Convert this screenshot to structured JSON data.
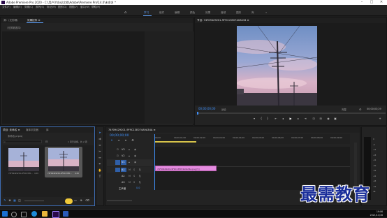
{
  "app": {
    "title": "Adobe Premiere Pro 2020 - C:\\用户\\Ysbsj\\文档\\Adobe\\Premiere Pro\\14.0\\未命名 *",
    "logo_color": "#2a0a4a",
    "window_controls": {
      "minimize": "–",
      "maximize": "□",
      "close": "✕"
    }
  },
  "menubar": [
    "文件(F)",
    "编辑(E)",
    "剪辑(C)",
    "序列(S)",
    "标记(M)",
    "图形(G)",
    "视图(V)",
    "窗口(W)",
    "帮助(H)"
  ],
  "workspaces": {
    "home_icon": "home-icon",
    "tabs": [
      "学习",
      "组件",
      "编辑",
      "颜色",
      "效果",
      "音频",
      "图形",
      "库"
    ],
    "active_index": 0,
    "more": "»",
    "accent": "#5b9bf2"
  },
  "source_panel": {
    "tabs": [
      "源：(无剪辑)",
      "效果控件 ≡"
    ],
    "active_index": 1,
    "message": "（无剪辑选择）"
  },
  "program_monitor": {
    "title": "节目: 74F09429201-9F9C13E074A9A34 ≡",
    "timecode_left": "00;00;00;00",
    "fit": "适合",
    "quality": "完整",
    "timecode_right": "00;00;03;29",
    "controls": [
      "marker-icon",
      "in-point-icon",
      "out-point-icon",
      "go-to-in-icon",
      "step-back-icon",
      "play-icon",
      "step-forward-icon",
      "go-to-out-icon",
      "insert-icon",
      "overwrite-icon",
      "export-frame-icon",
      "compare-icon"
    ],
    "plus": "+"
  },
  "project_panel": {
    "tabs": [
      "项目: 未命名 ≡",
      "媒体浏览器",
      "库"
    ],
    "active_index": 0,
    "path": "未命名.prproj",
    "search_placeholder": "",
    "item_count": "1 项已选择，共 2 项",
    "items": [
      {
        "name": "74F09429201-9F9C13E0...",
        "duration": "4;29"
      },
      {
        "name": "74F09429201-9F9C13E0...",
        "duration": "4;29"
      }
    ]
  },
  "tools": [
    "selection-tool-icon",
    "track-select-icon",
    "ripple-edit-icon",
    "razor-icon",
    "slip-icon",
    "pen-icon",
    "hand-icon",
    "type-icon"
  ],
  "timeline": {
    "tab": "74F09429201-9F9C13E074A9A34A ≡",
    "timecode": "00;00;00;00",
    "ruler": [
      ";00;00",
      "00;00;01;00",
      "00;00;02;00",
      "00;00;03;00",
      "00;00;04;00",
      "00;00;05;00",
      "00;00;06;00",
      "00;00;07;00",
      "00;00;08;00",
      "00;00;09;00"
    ],
    "video_tracks": [
      "V3",
      "V2",
      "V1"
    ],
    "audio_tracks": [
      "A1",
      "A2",
      "A3"
    ],
    "master": "主声道",
    "master_value": "0.0",
    "clip_label": "74F09429201-9F9C13E074A9A34A.png [V]",
    "clip_color": "#e58ce0",
    "audio_meter_labels": [
      "0",
      "-6",
      "-12",
      "-18",
      "-24",
      "-30",
      "-36",
      "-42",
      "-48",
      "-54",
      "dB"
    ]
  },
  "taskbar": {
    "time": "19:06",
    "date": "2021/11/16",
    "icons": [
      "windows-icon",
      "search-icon",
      "task-view-icon",
      "edge-icon",
      "explorer-icon",
      "premiere-icon",
      "word-icon"
    ]
  },
  "watermark": "最需教育"
}
